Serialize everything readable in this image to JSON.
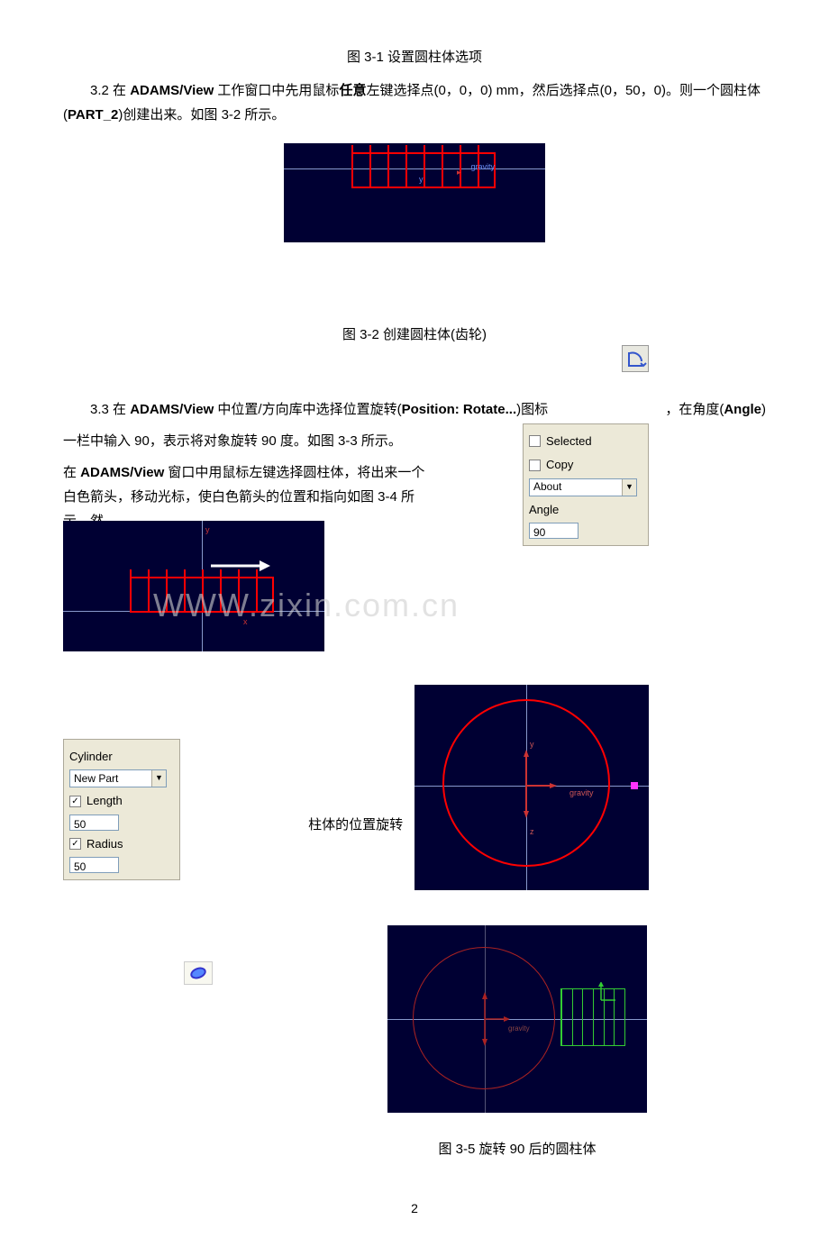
{
  "captions": {
    "fig31": "图 3-1 设置圆柱体选项",
    "fig32": "图 3-2 创建圆柱体(齿轮)",
    "fig35": "图 3-5 旋转 90 后的圆柱体"
  },
  "para32": {
    "p1a": "3.2 在 ",
    "p1b": "ADAMS/View",
    "p1c": " 工作窗口中先用鼠标",
    "p1d": "任意",
    "p1e": "左键选择点(0，0，0) mm，然后选择点(0，50，0)。则一个圆柱体(",
    "p1f": "PART_2",
    "p1g": ")创建出来。如图 3-2 所示。"
  },
  "para33": {
    "p1a": "3.3 在 ",
    "p1b": "ADAMS/View",
    "p1c": " 中位置/方向库中选择位置旋转(",
    "p1d": "Position: Rotate...",
    "p1e": ")图标",
    "p2": "，在角度(",
    "p2b": "Angle",
    "p2c": ")",
    "p3": "一栏中输入 90，表示将对象旋转 90 度。如图 3-3 所示。",
    "p4a": "在 ",
    "p4b": "ADAMS/View",
    "p4c": " 窗口中用鼠标左键选择圆柱体，将出来一个白色箭头，移动光标，使白色箭头的位置和指向如图 3-4 所示。然"
  },
  "rotate_panel": {
    "selected": "Selected",
    "copy": "Copy",
    "about": "About",
    "angle_label": "Angle",
    "angle_value": "90"
  },
  "cyl_panel": {
    "title": "Cylinder",
    "newpart": "New Part",
    "length_label": "Length",
    "length_value": "50",
    "radius_label": "Radius",
    "radius_value": "50"
  },
  "fragment": "柱体的位置旋转",
  "view_labels": {
    "gravity": "gravity",
    "x": "x",
    "y": "y",
    "z": "z"
  },
  "page_number": "2"
}
